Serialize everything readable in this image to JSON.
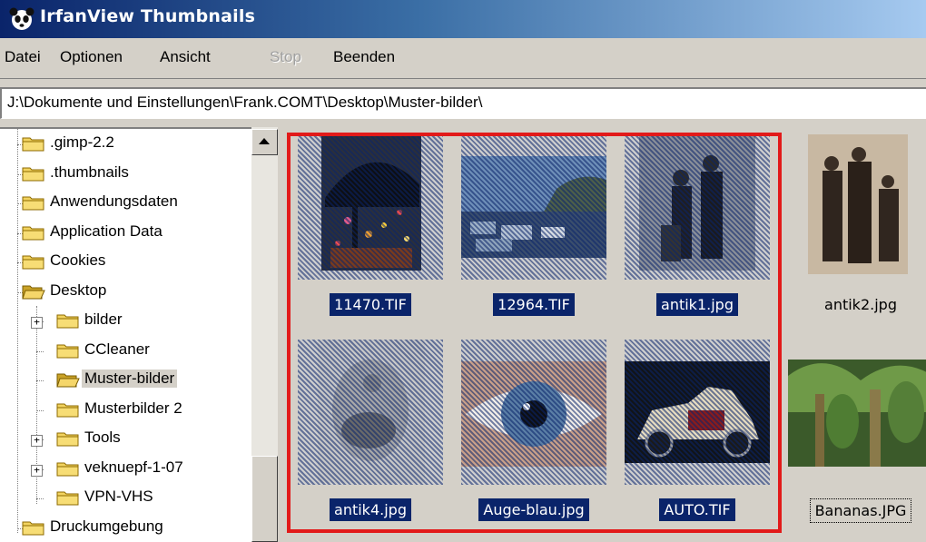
{
  "window": {
    "title": "IrfanView Thumbnails",
    "icon": "irfanview-panda-icon"
  },
  "menu": {
    "items": [
      {
        "label": "Datei",
        "enabled": true
      },
      {
        "label": "Optionen",
        "enabled": true
      },
      {
        "label": "Ansicht",
        "enabled": true
      },
      {
        "label": "Stop",
        "enabled": false
      },
      {
        "label": "Beenden",
        "enabled": true
      }
    ]
  },
  "path": {
    "value": "J:\\Dokumente und Einstellungen\\Frank.COMT\\Desktop\\Muster-bilder\\"
  },
  "tree": {
    "items": [
      {
        "label": ".gimp-2.2",
        "level": 0,
        "icon": "folder-icon"
      },
      {
        "label": ".thumbnails",
        "level": 0,
        "icon": "folder-icon"
      },
      {
        "label": "Anwendungsdaten",
        "level": 0,
        "icon": "folder-icon"
      },
      {
        "label": "Application Data",
        "level": 0,
        "icon": "folder-icon"
      },
      {
        "label": "Cookies",
        "level": 0,
        "icon": "folder-icon"
      },
      {
        "label": "Desktop",
        "level": 0,
        "icon": "folder-open-icon"
      },
      {
        "label": "bilder",
        "level": 1,
        "icon": "folder-icon",
        "expander": "+"
      },
      {
        "label": "CCleaner",
        "level": 1,
        "icon": "folder-icon"
      },
      {
        "label": "Muster-bilder",
        "level": 1,
        "icon": "folder-open-icon",
        "selected": true
      },
      {
        "label": "Musterbilder 2",
        "level": 1,
        "icon": "folder-icon"
      },
      {
        "label": "Tools",
        "level": 1,
        "icon": "folder-icon",
        "expander": "+"
      },
      {
        "label": "veknuepf-1-07",
        "level": 1,
        "icon": "folder-icon",
        "expander": "+"
      },
      {
        "label": "VPN-VHS",
        "level": 1,
        "icon": "folder-icon"
      },
      {
        "label": "Druckumgebung",
        "level": 0,
        "icon": "folder-icon"
      }
    ]
  },
  "thumbnails": [
    {
      "name": "11470.TIF",
      "selected": true
    },
    {
      "name": "12964.TIF",
      "selected": true
    },
    {
      "name": "antik1.jpg",
      "selected": true
    },
    {
      "name": "antik2.jpg",
      "selected": false
    },
    {
      "name": "antik4.jpg",
      "selected": true
    },
    {
      "name": "Auge-blau.jpg",
      "selected": true
    },
    {
      "name": "AUTO.TIF",
      "selected": true
    },
    {
      "name": "Bananas.JPG",
      "selected": false,
      "focused": true
    }
  ],
  "colors": {
    "selection": "#0a246a",
    "highlight_frame": "#e21a1a",
    "window_bg": "#d4d0c8"
  }
}
